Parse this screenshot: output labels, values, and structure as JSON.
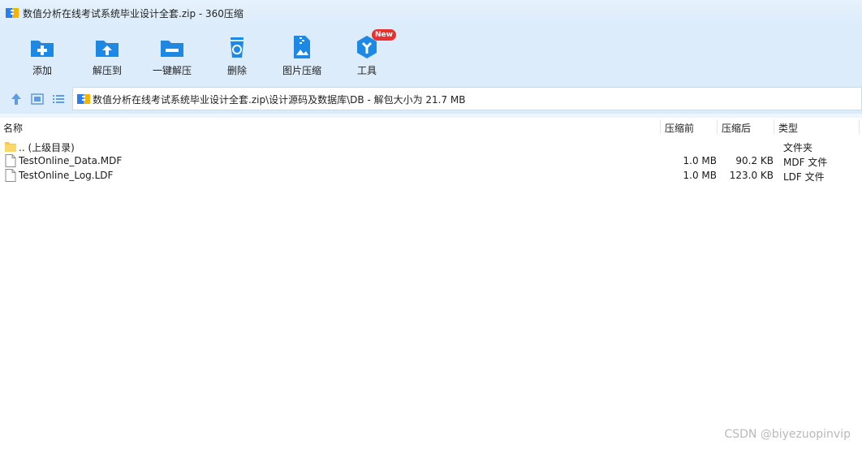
{
  "window": {
    "title": "数值分析在线考试系统毕业设计全套.zip - 360压缩"
  },
  "toolbar": {
    "items": [
      {
        "label": "添加",
        "icon": "add-folder-icon"
      },
      {
        "label": "解压到",
        "icon": "extract-to-icon"
      },
      {
        "label": "一键解压",
        "icon": "one-click-extract-icon"
      },
      {
        "label": "删除",
        "icon": "delete-icon"
      },
      {
        "label": "图片压缩",
        "icon": "image-compress-icon"
      },
      {
        "label": "工具",
        "icon": "tools-icon",
        "badge": "New"
      }
    ]
  },
  "address": {
    "path": "数值分析在线考试系统毕业设计全套.zip\\设计源码及数据库\\DB - 解包大小为 21.7 MB"
  },
  "columns": {
    "name": "名称",
    "before": "压缩前",
    "after": "压缩后",
    "type": "类型"
  },
  "rows": [
    {
      "name": ".. (上级目录)",
      "before": "",
      "after": "",
      "type": "文件夹",
      "icon": "folder-icon"
    },
    {
      "name": "TestOnline_Data.MDF",
      "before": "1.0 MB",
      "after": "90.2 KB",
      "type": "MDF 文件",
      "icon": "file-icon"
    },
    {
      "name": "TestOnline_Log.LDF",
      "before": "1.0 MB",
      "after": "123.0 KB",
      "type": "LDF 文件",
      "icon": "file-icon"
    }
  ],
  "watermark": "CSDN @biyezuopinvip",
  "colors": {
    "accent": "#1e88e5",
    "toolbar_bg": "#dcecfb",
    "badge": "#e8322e"
  }
}
